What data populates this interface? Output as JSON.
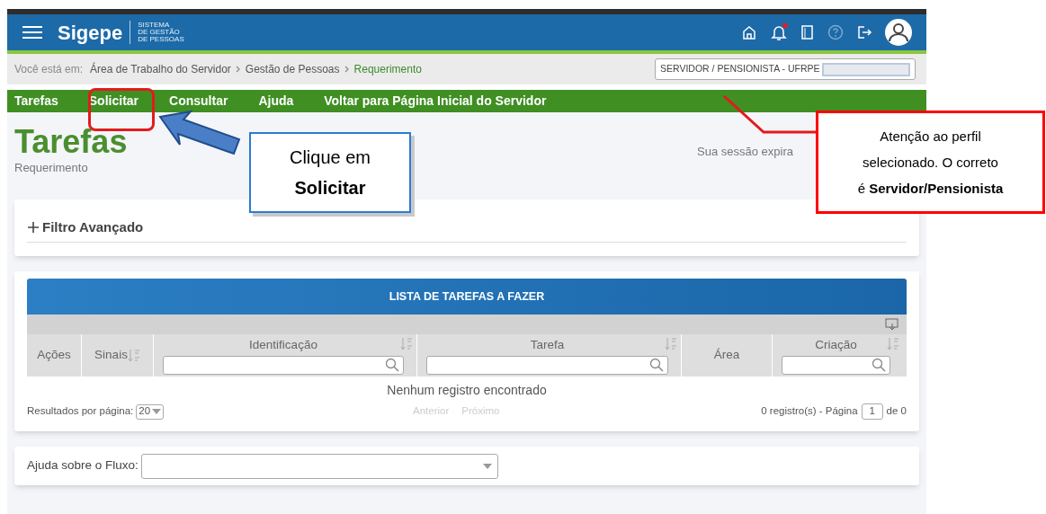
{
  "header": {
    "logo": "Sigepe",
    "subtitle": [
      "SISTEMA",
      "DE GESTÃO",
      "DE PESSOAS"
    ],
    "notification_dot": true
  },
  "breadcrumb": {
    "label": "Você está em:",
    "items": [
      {
        "label": "Área de Trabalho do Servidor",
        "current": false
      },
      {
        "label": "Gestão de Pessoas",
        "current": false
      },
      {
        "label": "Requerimento",
        "current": true
      }
    ]
  },
  "profile": {
    "value": "SERVIDOR / PENSIONISTA - UFRPE"
  },
  "nav": [
    {
      "label": "Tarefas"
    },
    {
      "label": "Solicitar"
    },
    {
      "label": "Consultar"
    },
    {
      "label": "Ajuda"
    },
    {
      "label": "Voltar para Página Inicial do Servidor"
    }
  ],
  "page": {
    "title": "Tarefas",
    "subtitle": "Requerimento",
    "session": "Sua sessão expira"
  },
  "filter": {
    "label": "Filtro Avançado"
  },
  "table": {
    "title": "LISTA DE TAREFAS A FAZER",
    "columns": [
      {
        "label": "Ações",
        "sortable": false,
        "search": false
      },
      {
        "label": "Sinais",
        "sortable": true,
        "search": false
      },
      {
        "label": "Identificação",
        "sortable": true,
        "search": true
      },
      {
        "label": "Tarefa",
        "sortable": true,
        "search": true
      },
      {
        "label": "Área",
        "sortable": false,
        "search": false
      },
      {
        "label": "Criação",
        "sortable": true,
        "search": true
      }
    ],
    "empty_message": "Nenhum registro encontrado",
    "per_page_label": "Resultados por página:",
    "per_page": "20",
    "previous": "Anterior",
    "next": "Próximo",
    "summary": "0 registro(s) - Página",
    "page": "1",
    "page_total": "de 0"
  },
  "flow_help": {
    "label": "Ajuda sobre o Fluxo:"
  },
  "annotations": [
    {
      "kind": "callout",
      "lines": [
        "Clique em",
        "**Solicitar**"
      ]
    },
    {
      "kind": "warning",
      "lines": [
        "Atenção ao perfil",
        "selecionado. O correto",
        "é **Servidor/Pensionista**"
      ]
    }
  ]
}
